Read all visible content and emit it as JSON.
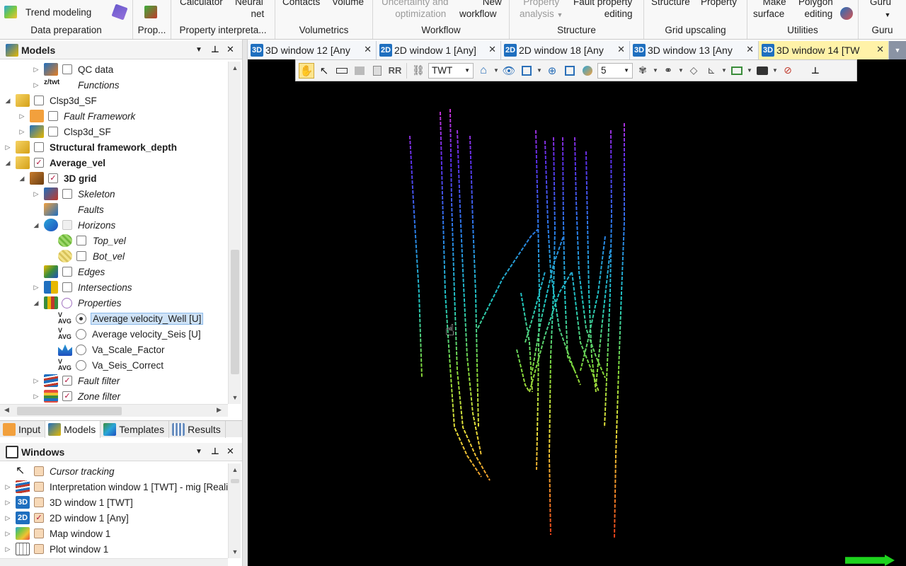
{
  "ribbon": {
    "groups": {
      "data_preparation": "Data preparation",
      "prop": "Prop...",
      "property_interp": "Property  interpreta...",
      "volumetrics": "Volumetrics",
      "workflow": "Workflow",
      "structure": "Structure",
      "grid_upscaling": "Grid upscaling",
      "utilities": "Utilities",
      "guru": "Guru"
    },
    "buttons": {
      "trend_modeling": "Trend modeling",
      "calculator": "Calculator",
      "neural_net_1": "Neural",
      "neural_net_2": "net",
      "contacts": "Contacts",
      "volume": "Volume",
      "uncertainty_1": "Uncertainty and",
      "uncertainty_2": "optimization",
      "new_workflow_1": "New",
      "new_workflow_2": "workflow",
      "property_analysis_1": "Property",
      "property_analysis_2": "analysis",
      "fault_property_1": "Fault property",
      "fault_property_2": "editing",
      "structure": "Structure",
      "property": "Property",
      "make_surface_1": "Make",
      "make_surface_2": "surface",
      "polygon_editing_1": "Polygon",
      "polygon_editing_2": "editing",
      "guru": "Guru"
    }
  },
  "models_panel": {
    "title": "Models",
    "items": [
      {
        "label": "QC data"
      },
      {
        "label": "Functions"
      },
      {
        "label": "Clsp3d_SF"
      },
      {
        "label": "Fault Framework"
      },
      {
        "label": "Clsp3d_SF"
      },
      {
        "label": "Structural framework_depth"
      },
      {
        "label": "Average_vel"
      },
      {
        "label": "3D grid"
      },
      {
        "label": "Skeleton"
      },
      {
        "label": "Faults"
      },
      {
        "label": "Horizons"
      },
      {
        "label": "Top_vel"
      },
      {
        "label": "Bot_vel"
      },
      {
        "label": "Edges"
      },
      {
        "label": "Intersections"
      },
      {
        "label": "Properties"
      },
      {
        "label": "Average velocity_Well [U]"
      },
      {
        "label": "Average velocity_Seis [U]"
      },
      {
        "label": "Va_Scale_Factor"
      },
      {
        "label": "Va_Seis_Correct"
      },
      {
        "label": "Fault filter"
      },
      {
        "label": "Zone filter"
      }
    ]
  },
  "pane_tabs": [
    {
      "label": "Input"
    },
    {
      "label": "Models"
    },
    {
      "label": "Templates"
    },
    {
      "label": "Results"
    }
  ],
  "windows_panel": {
    "title": "Windows",
    "items": [
      {
        "label": "Cursor tracking"
      },
      {
        "label": "Interpretation window 1 [TWT] - mig [Realiz"
      },
      {
        "label": "3D window 1 [TWT]"
      },
      {
        "label": "2D window 1 [Any]"
      },
      {
        "label": "Map window 1"
      },
      {
        "label": "Plot window 1"
      }
    ]
  },
  "window_tabs": [
    {
      "badge": "3D",
      "label": "3D window 12 [Any"
    },
    {
      "badge": "2D",
      "label": "2D window 1 [Any]"
    },
    {
      "badge": "2D",
      "label": "2D window 18 [Any"
    },
    {
      "badge": "3D",
      "label": "3D window 13 [Any"
    },
    {
      "badge": "3D",
      "label": "3D window 14 [TW"
    }
  ],
  "viewer_toolbar": {
    "domain_select": "TWT",
    "value_select": "5"
  },
  "colors": {
    "active_tab": "#fff2a8",
    "badge_3d": "#1f6fbf",
    "badge_2d": "#1f6fbf",
    "viewport_bg": "#000000",
    "selection": "#cfe3f7"
  }
}
